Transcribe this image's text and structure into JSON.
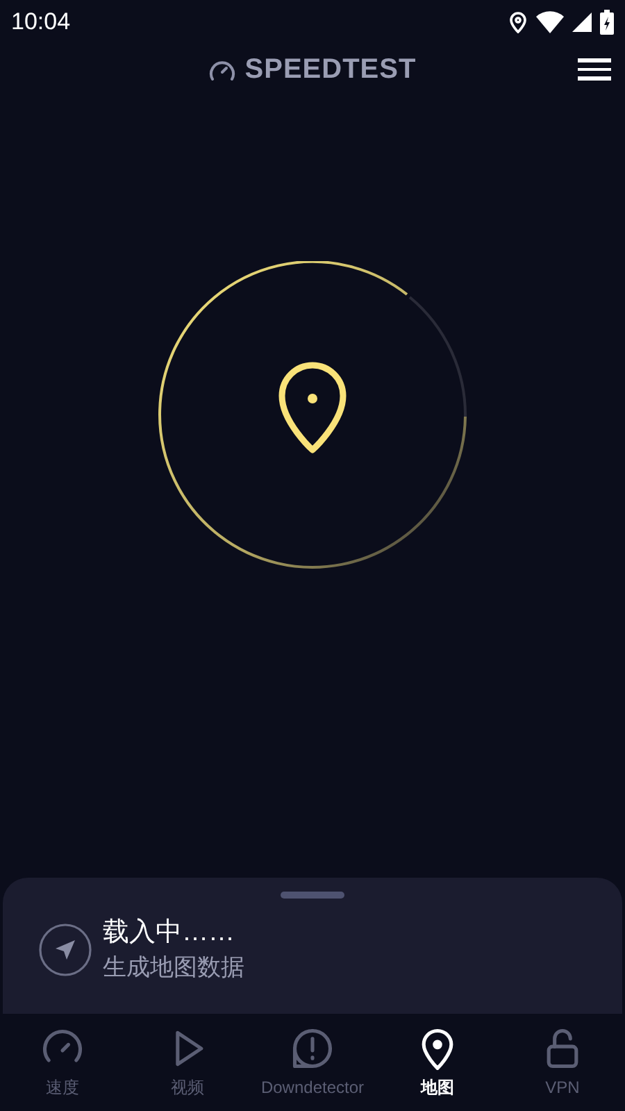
{
  "status_bar": {
    "time": "10:04"
  },
  "header": {
    "title": "SPEEDTEST"
  },
  "loading_sheet": {
    "title": "载入中……",
    "subtitle": "生成地图数据"
  },
  "tabs": [
    {
      "label": "速度",
      "kind": "speed",
      "selected": false
    },
    {
      "label": "视频",
      "kind": "video",
      "selected": false
    },
    {
      "label": "Downdetector",
      "kind": "alert",
      "selected": false
    },
    {
      "label": "地图",
      "kind": "map",
      "selected": true
    },
    {
      "label": "VPN",
      "kind": "vpn",
      "selected": false
    }
  ]
}
